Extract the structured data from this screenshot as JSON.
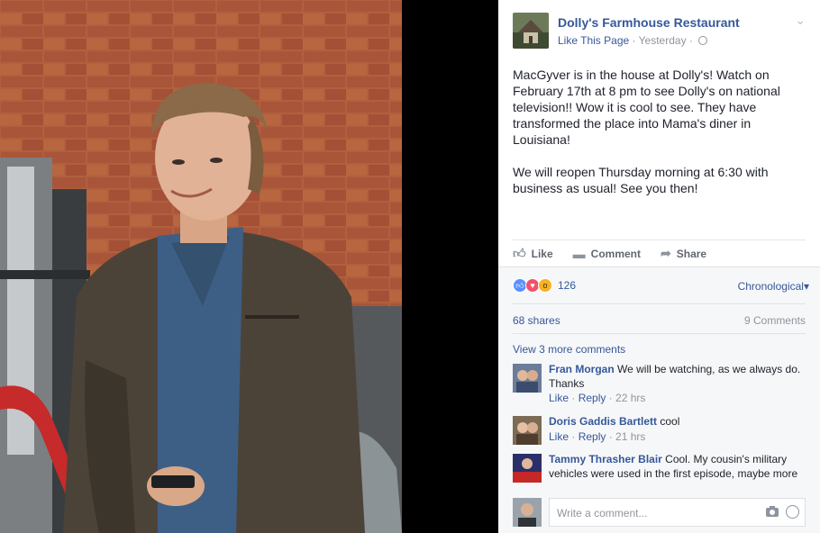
{
  "post": {
    "page_name": "Dolly's Farmhouse Restaurant",
    "like_page": "Like This Page",
    "timestamp": "Yesterday",
    "separator": "·",
    "body_p1": "MacGyver is in the house at Dolly's! Watch on February 17th at 8 pm to see Dolly's on national television!! Wow it is cool to see. They have transformed the place into Mama's diner in Louisiana!",
    "body_p2": "We will reopen Thursday morning at 6:30 with business as usual! See you then!"
  },
  "actions": {
    "like": "Like",
    "comment": "Comment",
    "share": "Share"
  },
  "feedback": {
    "reaction_count": "126",
    "sort": "Chronological",
    "shares": "68 shares",
    "comments": "9 Comments",
    "view_more": "View 3 more comments"
  },
  "comments": [
    {
      "author": "Fran Morgan",
      "text": "We will be watching, as we always do. Thanks",
      "like": "Like",
      "reply": "Reply",
      "time": "22 hrs"
    },
    {
      "author": "Doris Gaddis Bartlett",
      "text": "cool",
      "like": "Like",
      "reply": "Reply",
      "time": "21 hrs"
    },
    {
      "author": "Tammy Thrasher Blair",
      "text": "Cool. My cousin's military vehicles were used in the first episode, maybe more"
    }
  ],
  "composer": {
    "placeholder": "Write a comment..."
  },
  "colors": {
    "link": "#365899",
    "muted": "#90949c",
    "brick": "#a8553a"
  },
  "icons": [
    "chevron-down-icon",
    "globe-icon",
    "thumbs-up-icon",
    "comment-icon",
    "share-icon",
    "camera-icon",
    "smiley-icon"
  ]
}
